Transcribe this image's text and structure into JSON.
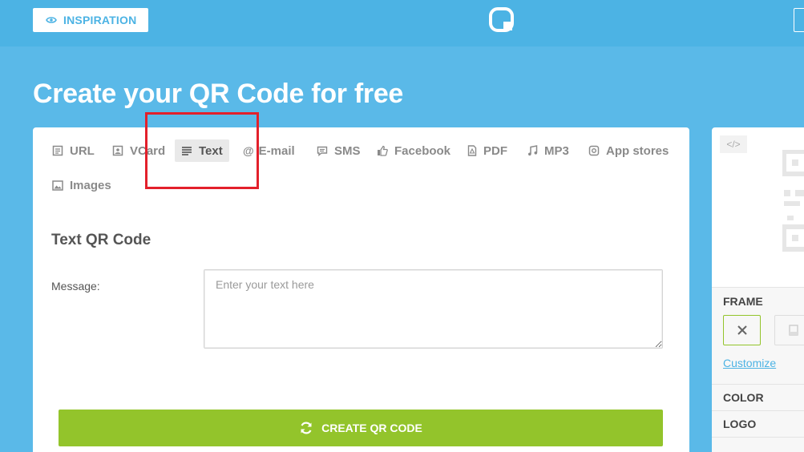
{
  "header": {
    "inspiration_label": "INSPIRATION"
  },
  "page": {
    "title": "Create your QR Code for free"
  },
  "tabs": [
    {
      "label": "URL",
      "icon": "link-doc-icon"
    },
    {
      "label": "VCard",
      "icon": "contact-card-icon"
    },
    {
      "label": "Text",
      "icon": "text-lines-icon",
      "active": true
    },
    {
      "label": "E-mail",
      "icon": "at-icon"
    },
    {
      "label": "SMS",
      "icon": "chat-icon"
    },
    {
      "label": "Facebook",
      "icon": "thumbs-up-icon"
    },
    {
      "label": "PDF",
      "icon": "pdf-icon"
    },
    {
      "label": "MP3",
      "icon": "music-note-icon"
    },
    {
      "label": "App stores",
      "icon": "app-store-icon"
    },
    {
      "label": "Images",
      "icon": "image-icon"
    }
  ],
  "form": {
    "section_title": "Text QR Code",
    "message_label": "Message:",
    "message_placeholder": "Enter your text here",
    "message_value": "",
    "create_button": "CREATE QR CODE"
  },
  "sidebar": {
    "embed_code_icon": "</>",
    "frame_label": "FRAME",
    "customize_link": "Customize",
    "color_label": "COLOR",
    "logo_label": "LOGO"
  },
  "colors": {
    "background": "#4cb3e4",
    "accent_green": "#93c42b",
    "highlight_red": "#e3202b",
    "link_blue": "#4cb3e4"
  }
}
